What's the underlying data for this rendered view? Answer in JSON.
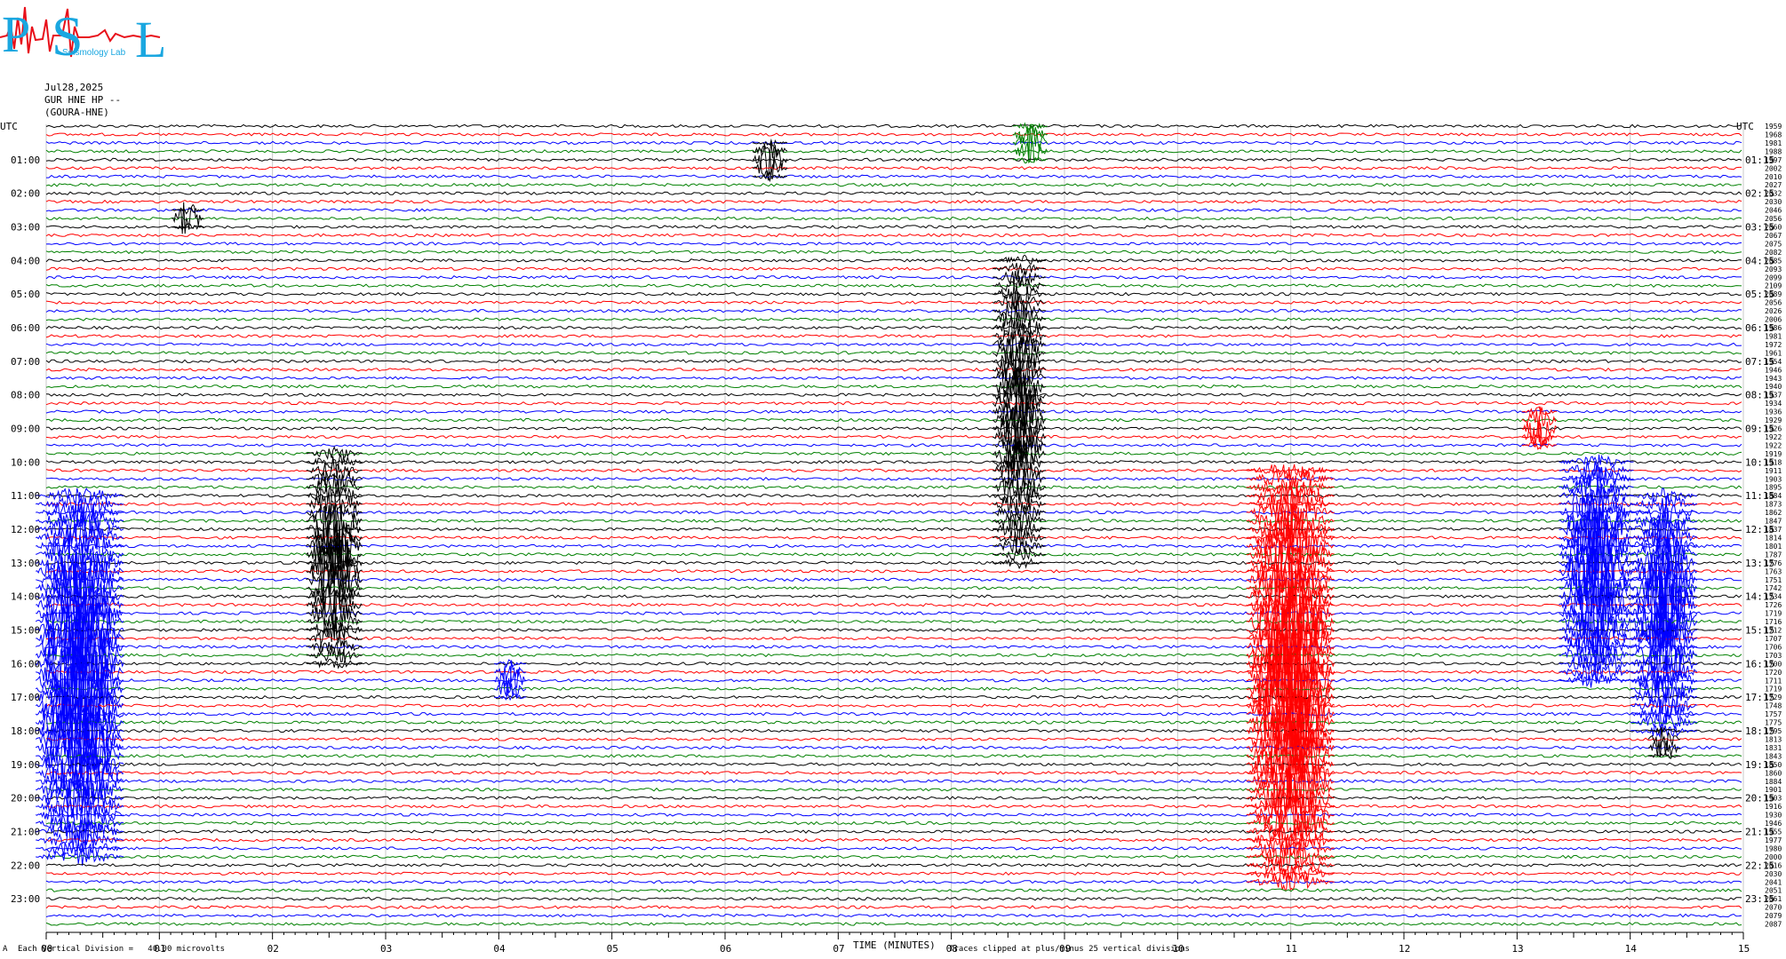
{
  "logo": {
    "letters": [
      "P",
      "S",
      "L"
    ],
    "subtitle": "Seismology Lab",
    "colors": {
      "letters": "#1aa7e0",
      "wave": "#e8101a"
    }
  },
  "header": {
    "date": "Jul28,2025",
    "station": "GUR HNE HP --",
    "location": "(GOURA-HNE)"
  },
  "footer": {
    "division": "Each Vertical Division =   40.00 microvolts",
    "clip": "Traces clipped at plus/minus 25 vertical divisions",
    "corner": "A"
  },
  "chart_data": {
    "type": "line",
    "xlabel": "TIME (MINUTES)",
    "xlim": [
      0,
      15
    ],
    "x_ticks": [
      "00",
      "01",
      "02",
      "03",
      "04",
      "05",
      "06",
      "07",
      "08",
      "09",
      "10",
      "11",
      "12",
      "13",
      "14",
      "15"
    ],
    "left_axis_title": "UTC",
    "right_axis_title": "UTC",
    "left_labels": [
      "01:00",
      "02:00",
      "03:00",
      "04:00",
      "05:00",
      "06:00",
      "07:00",
      "08:00",
      "09:00",
      "10:00",
      "11:00",
      "12:00",
      "13:00",
      "14:00",
      "15:00",
      "16:00",
      "17:00",
      "18:00",
      "19:00",
      "20:00",
      "21:00",
      "22:00",
      "23:00"
    ],
    "right_labels": [
      "01:15",
      "02:15",
      "03:15",
      "04:15",
      "05:15",
      "06:15",
      "07:15",
      "08:15",
      "09:15",
      "10:15",
      "11:15",
      "12:15",
      "13:15",
      "14:15",
      "15:15",
      "16:15",
      "17:15",
      "18:15",
      "19:15",
      "20:15",
      "21:15",
      "22:15",
      "23:15"
    ],
    "trace_count": 96,
    "trace_color_cycle": [
      "#000000",
      "#ff0000",
      "#0000ff",
      "#008000"
    ],
    "trace_offsets": [
      "1959",
      "1968",
      "1981",
      "1988",
      "1997",
      "2002",
      "2010",
      "2027",
      "2032",
      "2030",
      "2046",
      "2056",
      "2060",
      "2067",
      "2075",
      "2082",
      "2085",
      "2093",
      "2099",
      "2109",
      "2089",
      "2056",
      "2026",
      "2006",
      "1986",
      "1981",
      "1972",
      "1961",
      "1954",
      "1946",
      "1943",
      "1940",
      "1937",
      "1934",
      "1936",
      "1929",
      "1926",
      "1922",
      "1922",
      "1919",
      "1918",
      "1911",
      "1903",
      "1895",
      "1884",
      "1873",
      "1862",
      "1847",
      "1837",
      "1814",
      "1801",
      "1787",
      "1776",
      "1763",
      "1751",
      "1742",
      "1734",
      "1726",
      "1719",
      "1716",
      "1712",
      "1707",
      "1706",
      "1703",
      "1700",
      "1720",
      "1711",
      "1719",
      "1729",
      "1748",
      "1757",
      "1775",
      "1795",
      "1813",
      "1831",
      "1843",
      "1850",
      "1860",
      "1884",
      "1901",
      "1903",
      "1916",
      "1930",
      "1946",
      "1955",
      "1977",
      "1980",
      "2000",
      "2016",
      "2030",
      "2041",
      "2051",
      "2061",
      "2070",
      "2079",
      "2087"
    ],
    "events": [
      {
        "minute": 0.3,
        "trace_start": 44,
        "trace_end": 87,
        "color": "#0000ff",
        "amp": 1.0
      },
      {
        "minute": 2.55,
        "trace_start": 39,
        "trace_end": 64,
        "color": "#000000",
        "amp": 0.55
      },
      {
        "minute": 8.6,
        "trace_start": 16,
        "trace_end": 52,
        "color": "#000000",
        "amp": 0.5
      },
      {
        "minute": 11.0,
        "trace_start": 41,
        "trace_end": 90,
        "color": "#ff0000",
        "amp": 1.0
      },
      {
        "minute": 13.7,
        "trace_start": 40,
        "trace_end": 66,
        "color": "#0000ff",
        "amp": 0.8
      },
      {
        "minute": 14.3,
        "trace_start": 44,
        "trace_end": 72,
        "color": "#0000ff",
        "amp": 0.7
      },
      {
        "minute": 6.4,
        "trace_start": 2,
        "trace_end": 6,
        "color": "#000000",
        "amp": 0.25
      },
      {
        "minute": 1.25,
        "trace_start": 10,
        "trace_end": 12,
        "color": "#000000",
        "amp": 0.2
      },
      {
        "minute": 8.7,
        "trace_start": 0,
        "trace_end": 4,
        "color": "#008000",
        "amp": 0.25
      },
      {
        "minute": 13.2,
        "trace_start": 34,
        "trace_end": 38,
        "color": "#ff0000",
        "amp": 0.25
      },
      {
        "minute": 4.1,
        "trace_start": 64,
        "trace_end": 68,
        "color": "#0000ff",
        "amp": 0.2
      },
      {
        "minute": 14.3,
        "trace_start": 72,
        "trace_end": 75,
        "color": "#000000",
        "amp": 0.2
      }
    ]
  }
}
